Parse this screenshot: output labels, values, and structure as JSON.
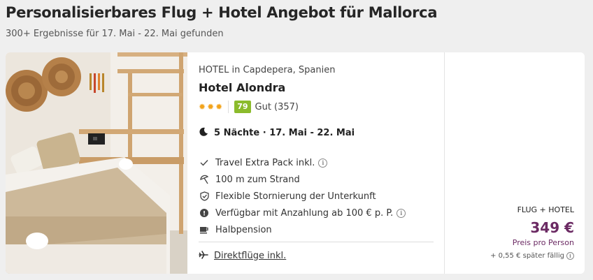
{
  "header": {
    "title": "Personalisierbares Flug + Hotel Angebot für Mallorca",
    "subtitle": "300+ Ergebnisse für 17. Mai - 22. Mai gefunden"
  },
  "offer": {
    "type_location": "HOTEL in Capdepera, Spanien",
    "hotel_name": "Hotel Alondra",
    "stars": 3,
    "score": "79",
    "rating_text": "Gut (357)",
    "nights": "5 Nächte · 17. Mai - 22. Mai",
    "features": [
      {
        "icon": "check-icon",
        "label": "Travel Extra Pack inkl.",
        "info": true
      },
      {
        "icon": "beach-umbrella-icon",
        "label": "100 m zum Strand",
        "info": false
      },
      {
        "icon": "shield-check-icon",
        "label": "Flexible Stornierung der Unterkunft",
        "info": false
      },
      {
        "icon": "deposit-coin-icon",
        "label": "Verfügbar mit Anzahlung ab 100 € p. P.",
        "info": true
      },
      {
        "icon": "coffee-cup-icon",
        "label": "Halbpension",
        "info": false
      }
    ],
    "flight_link": "Direktflüge inkl."
  },
  "price": {
    "label": "FLUG + HOTEL",
    "amount": "349 €",
    "per_person": "Preis pro Person",
    "later": "+ 0,55 € später fällig"
  },
  "colors": {
    "price": "#6b2a63",
    "score_badge": "#8bbb2c",
    "stars": "#f2a31b"
  }
}
